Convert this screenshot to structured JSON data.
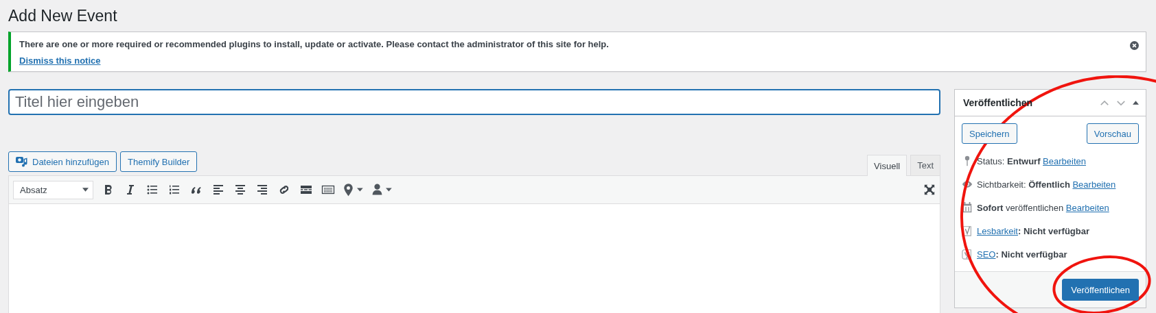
{
  "page_title": "Add New Event",
  "notice": {
    "message": "There are one or more required or recommended plugins to install, update or activate. Please contact the administrator of this site for help.",
    "dismiss_link": "Dismiss this notice"
  },
  "title_field": {
    "placeholder": "Titel hier eingeben"
  },
  "media_buttons": [
    {
      "label": "Dateien hinzufügen",
      "kind": "media"
    },
    {
      "label": "Themify Builder",
      "kind": "plain"
    }
  ],
  "editor_tabs": [
    {
      "label": "Visuell",
      "selected": true
    },
    {
      "label": "Text",
      "selected": false
    }
  ],
  "format_select": {
    "value": "Absatz"
  },
  "publish_box": {
    "title": "Veröffentlichen",
    "save_button": "Speichern",
    "preview_button": "Vorschau",
    "rows": [
      {
        "kind": "pin",
        "text": "Status: **Entwurf**",
        "link": "Bearbeiten"
      },
      {
        "kind": "eye",
        "text": "Sichtbarkeit: **Öffentlich**",
        "link": "Bearbeiten"
      },
      {
        "kind": "calendar",
        "text": "**Sofort** veröffentlichen",
        "link": "Bearbeiten"
      },
      {
        "kind": "yoast",
        "link": "Lesbarkeit",
        "text": ": Nicht verfügbar"
      },
      {
        "kind": "yoast-y",
        "link": "SEO",
        "text": ": Nicht verfügbar"
      }
    ],
    "publish_button": "Veröffentlichen"
  }
}
